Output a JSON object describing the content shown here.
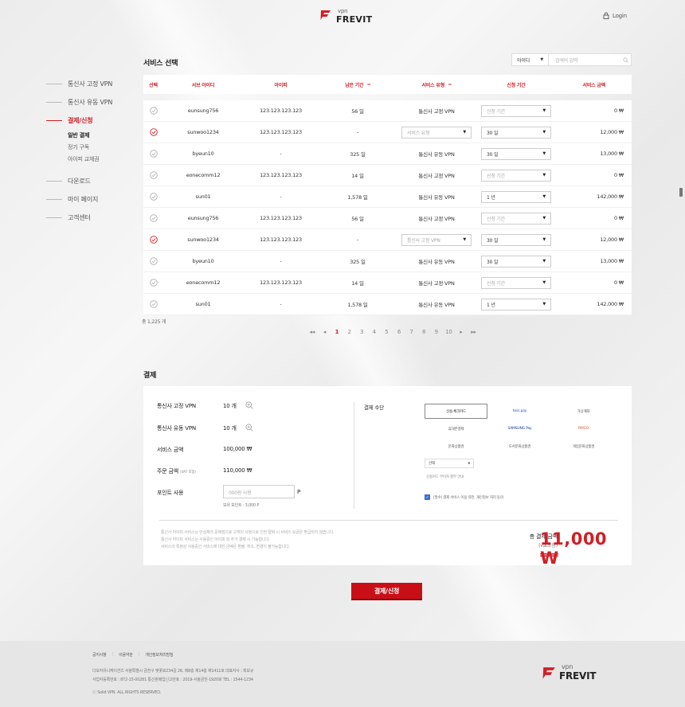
{
  "brand": {
    "vpn": "vpn",
    "name": "FREVIT"
  },
  "header": {
    "login": "Login"
  },
  "sidebar": {
    "items": [
      {
        "label": "통신사 고정 VPN",
        "active": false
      },
      {
        "label": "통신사 유동 VPN",
        "active": false
      },
      {
        "label": "결제/신청",
        "active": true
      }
    ],
    "subitems": [
      {
        "label": "일반 결제",
        "active": true
      },
      {
        "label": "정기 구독",
        "active": false
      },
      {
        "label": "아이피 교체권",
        "active": false
      }
    ],
    "items2": [
      {
        "label": "다운로드"
      },
      {
        "label": "마이 페이지"
      },
      {
        "label": "고객센터"
      }
    ]
  },
  "service": {
    "title": "서비스 선택",
    "search_select": "아이디",
    "search_placeholder": "검색어 입력",
    "columns": [
      "선택",
      "서브 아이디",
      "아이피",
      "남은 기간",
      "서비스 유형",
      "신청 기간",
      "서비스 금액"
    ],
    "rows": [
      {
        "checked": false,
        "id": "eunsung756",
        "ip": "123.123.123.123",
        "remain": "56 일",
        "type": "통신사 고정 VPN",
        "type_dd": false,
        "period": "신청 기간",
        "period_ph": true,
        "price": "0 ₩"
      },
      {
        "checked": true,
        "id": "sunwoo1234",
        "ip": "123.123.123.123",
        "remain": "-",
        "type": "서비스 유형",
        "type_dd": true,
        "type_ph": true,
        "period": "30 일",
        "period_ph": false,
        "price": "12,000 ₩"
      },
      {
        "checked": false,
        "id": "byeun10",
        "ip": "-",
        "remain": "325 일",
        "type": "통신사 유동 VPN",
        "type_dd": false,
        "period": "30 일",
        "period_ph": false,
        "price": "13,000 ₩"
      },
      {
        "checked": false,
        "id": "eonecomm12",
        "ip": "123.123.123.123",
        "remain": "14 일",
        "type": "통신사 고정 VPN",
        "type_dd": false,
        "period": "신청 기간",
        "period_ph": true,
        "price": "0 ₩"
      },
      {
        "checked": false,
        "id": "sun01",
        "ip": "-",
        "remain": "1,578 일",
        "type": "통신사 유동 VPN",
        "type_dd": false,
        "period": "1 년",
        "period_ph": false,
        "price": "142,000 ₩"
      },
      {
        "checked": false,
        "id": "eunsung756",
        "ip": "123.123.123.123",
        "remain": "56 일",
        "type": "통신사 고정 VPN",
        "type_dd": false,
        "period": "신청 기간",
        "period_ph": true,
        "price": "0 ₩"
      },
      {
        "checked": true,
        "id": "sunwoo1234",
        "ip": "123.123.123.123",
        "remain": "-",
        "type": "통신사 고정 VPN",
        "type_dd": true,
        "type_ph": true,
        "period": "30 일",
        "period_ph": false,
        "price": "12,000 ₩"
      },
      {
        "checked": false,
        "id": "byeun10",
        "ip": "-",
        "remain": "325 일",
        "type": "통신사 유동 VPN",
        "type_dd": false,
        "period": "30 일",
        "period_ph": false,
        "price": "13,000 ₩"
      },
      {
        "checked": false,
        "id": "eonecomm12",
        "ip": "123.123.123.123",
        "remain": "14 일",
        "type": "통신사 고정 VPN",
        "type_dd": false,
        "period": "신청 기간",
        "period_ph": true,
        "price": "0 ₩"
      },
      {
        "checked": false,
        "id": "sun01",
        "ip": "-",
        "remain": "1,578 일",
        "type": "통신사 유동 VPN",
        "type_dd": false,
        "period": "1 년",
        "period_ph": false,
        "price": "142,000 ₩"
      }
    ],
    "total": "총 1,225 개",
    "pages": [
      "1",
      "2",
      "3",
      "4",
      "5",
      "6",
      "7",
      "8",
      "9",
      "10"
    ],
    "current_page": "1"
  },
  "payment": {
    "title": "결제",
    "fixed_label": "통신사 고정 VPN",
    "fixed_value": "10 개",
    "dyn_label": "통신사 유동 VPN",
    "dyn_value": "10 개",
    "amount_label": "서비스 금액",
    "amount_value": "100,000 ₩",
    "order_label": "주문 금액",
    "order_sub": "(VAT 포함)",
    "order_value": "110,000 ₩",
    "point_label": "포인트 사용",
    "point_placeholder": "000원 사용",
    "point_unit": "P",
    "point_have": "보유 포인트 : 3,000 P",
    "method_label": "결제 수단",
    "methods": [
      "신용·체크카드",
      "toss pay",
      "가상계좌",
      "휴대폰결제",
      "SAMSUNG Pay",
      "PAYCO",
      "문화상품권",
      "도서문화상품권",
      "게임문화상품권"
    ],
    "card_select": "선택",
    "card_note": "신용카드 무이자 할부 안내",
    "agree": "[필수] 결제 서비스 이용 약관, 개인정보 처리 동의",
    "notice": [
      "통신사 아이피 서비스는 안심체크 문제점으로 고객의 사정으로 인한 탈퇴 시 서비스 요금은 환급되지 않습니다.",
      "통신사 아이피 서비스는 사용중인 아이피 외 추가 결제 시 가능합니다.",
      "서비스의 특정상 사용중인 서비스에 대한 금액은 환불, 취소, 변경이 불가능합니다."
    ],
    "total_label": "총 결제 금액",
    "total_sub": "(vat포함)",
    "total_value": "11,000 ₩",
    "submit": "결제/신청"
  },
  "footer": {
    "links": [
      "공지사항",
      "이용약관",
      "개인정보처리방침"
    ],
    "info": [
      "다보자유니케이션즈 서울특별시 금천구 벚꽃로234길 26, 제8층 제14층 제1411호 대표자사 : 최보규",
      "사업자등록번호 : 872-15-00281 통신판매업신고번호 : 2019-서울금천-1920호 TEL : 1544-1234",
      "ⓒ Solid VPN. ALL RIGHTS RESERVED."
    ]
  },
  "colors": {
    "accent": "#d21e24"
  }
}
